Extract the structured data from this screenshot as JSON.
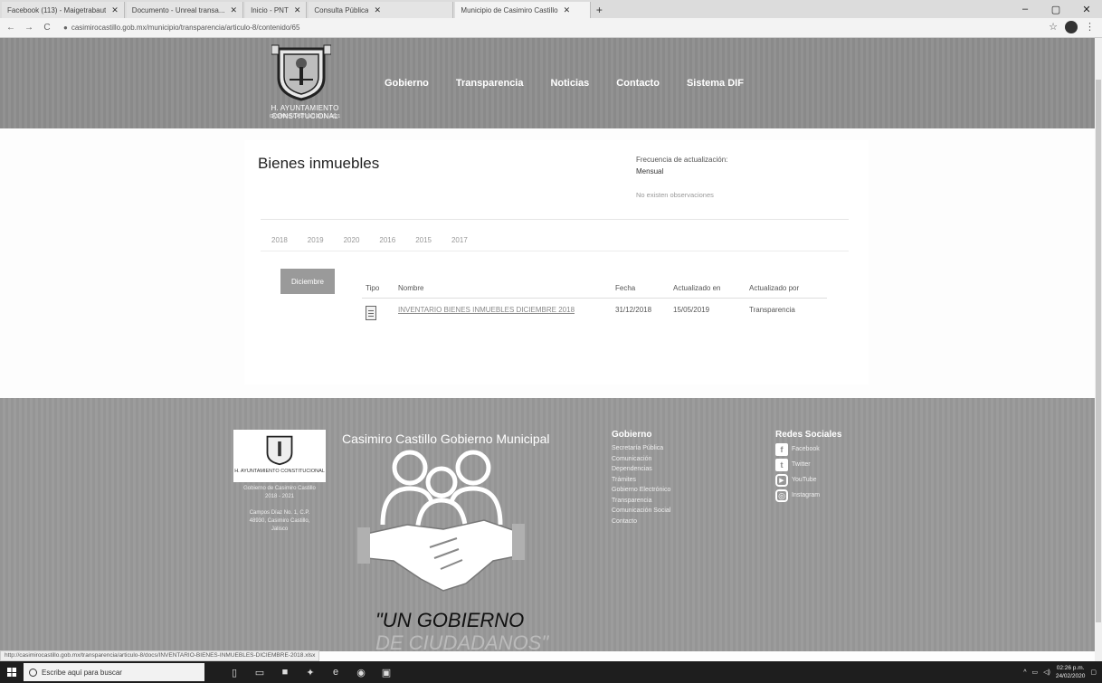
{
  "browser": {
    "tabs": [
      {
        "title": "Facebook (113) - Maigetrabaut"
      },
      {
        "title": "Documento - Unreal transa..."
      },
      {
        "title": "Inicio - PNT"
      },
      {
        "title": "Consulta Pública"
      },
      {
        "title": "Municipio de Casimiro Castillo"
      }
    ],
    "new_tab": "+",
    "url": "casimirocastillo.gob.mx/municipio/transparencia/articulo-8/contenido/65",
    "window_controls": {
      "minimize": "–",
      "maximize": "▢",
      "close": "✕"
    },
    "nav": {
      "back": "←",
      "forward": "→",
      "reload": "C"
    },
    "star": "☆"
  },
  "site": {
    "logo_text": "H. AYUNTAMIENTO CONSTITUCIONAL",
    "logo_subtext": "CASIMIRO CASTILLO 2018 - 2021",
    "nav": [
      "Gobierno",
      "Transparencia",
      "Noticias",
      "Contacto",
      "Sistema DIF"
    ]
  },
  "content": {
    "title": "Bienes inmuebles",
    "freq_label": "Frecuencia de actualización:",
    "freq_value": "Mensual",
    "no_obs": "No existen observaciones",
    "years": [
      "2018",
      "2019",
      "2020",
      "2016",
      "2015",
      "2017"
    ],
    "month_button": "Diciembre",
    "table": {
      "headers": [
        "Tipo",
        "Nombre",
        "Fecha",
        "Actualizado en",
        "Actualizado por"
      ],
      "rows": [
        {
          "name": "INVENTARIO BIENES INMUEBLES DICIEMBRE 2018",
          "date": "31/12/2018",
          "updated_on": "15/05/2019",
          "updated_by": "Transparencia"
        }
      ]
    }
  },
  "footer": {
    "logo_text": "H. AYUNTAMIENTO CONSTITUCIONAL",
    "address": [
      "Gobierno de Casimiro Castillo",
      "2018 - 2021",
      "",
      "Campos Díaz No. 1, C.P.",
      "48930, Casimiro Castillo,",
      "Jalisco"
    ],
    "title": "Casimiro Castillo Gobierno Municipal",
    "slogan_1": "\"UN GOBIERNO",
    "slogan_2": "DE CIUDADANOS\"",
    "gobierno": {
      "heading": "Gobierno",
      "items": [
        "Secretaría Pública",
        "Comunicación",
        "Dependencias",
        "Trámites",
        "Gobierno Electrónico",
        "Transparencia",
        "Comunicación Social",
        "Contacto"
      ]
    },
    "redes": {
      "heading": "Redes Sociales",
      "items": [
        {
          "icon": "f",
          "label": "Facebook"
        },
        {
          "icon": "t",
          "label": "Twitter"
        },
        {
          "icon": "▶",
          "label": "YouTube"
        },
        {
          "icon": "◎",
          "label": "Instagram"
        }
      ]
    }
  },
  "status_url": "http://casimirocastillo.gob.mx/transparencia/articulo-8/docs/INVENTARIO-BIENES-INMUEBLES-DICIEMBRE-2018.xlsx",
  "taskbar": {
    "search_placeholder": "Escribe aquí para buscar",
    "time": "02:26 p.m.",
    "date": "24/02/2020",
    "icons": [
      "task-view-icon",
      "file-explorer-icon",
      "mail-icon",
      "app-icon",
      "edge-icon",
      "chrome-icon",
      "word-icon"
    ]
  }
}
